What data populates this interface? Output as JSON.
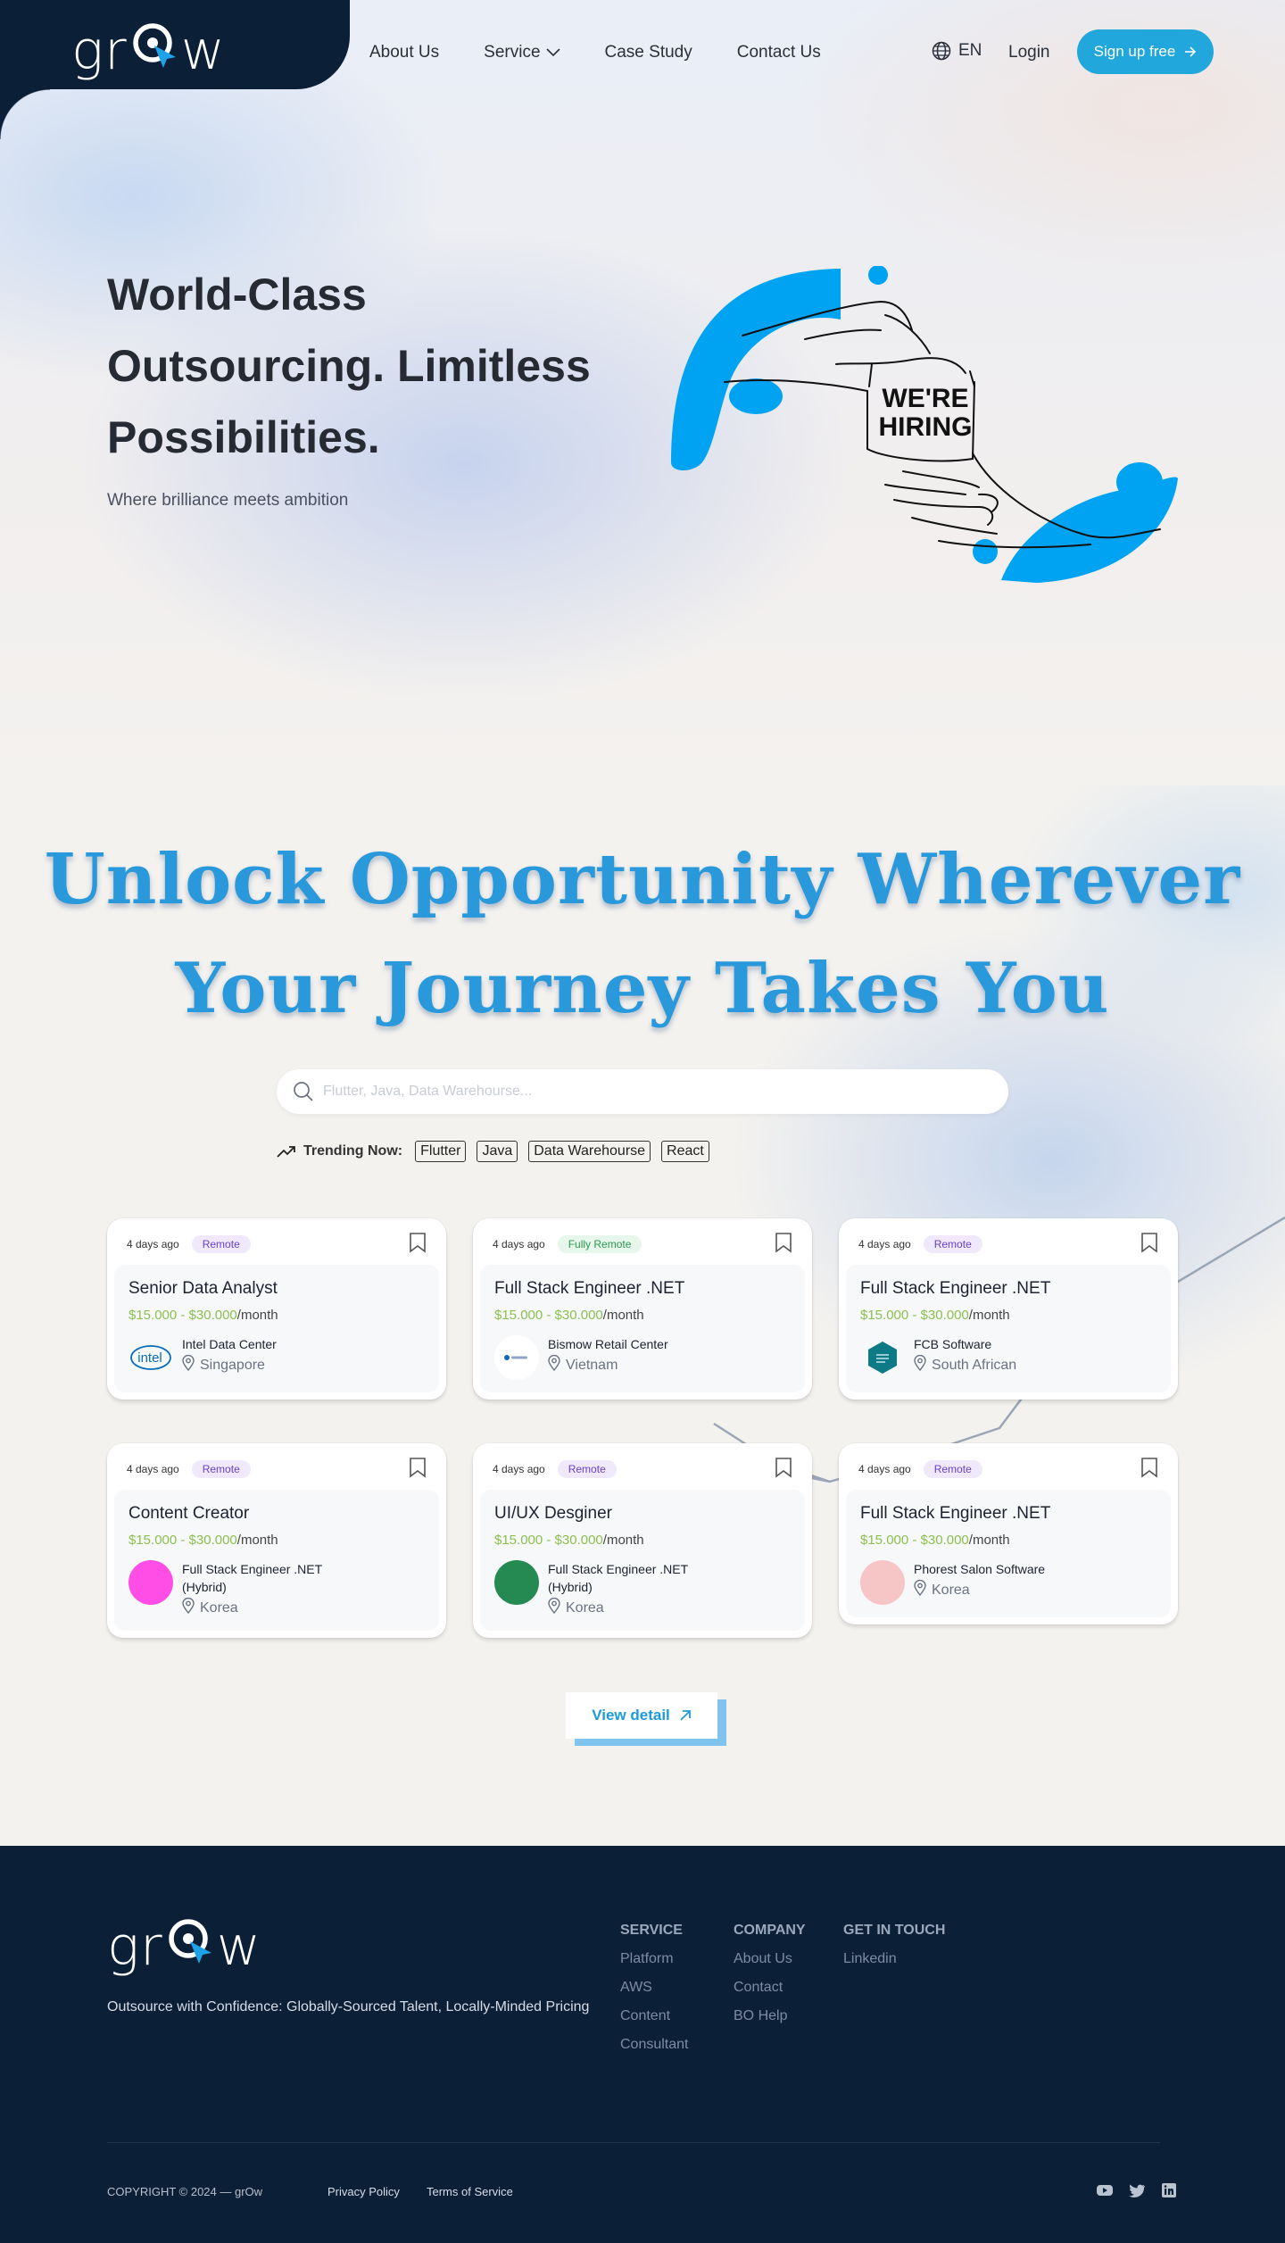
{
  "brand": {
    "logo_text_left": "gr",
    "logo_text_right": "w",
    "accent": "#22a7dc",
    "dark": "#0b1f36"
  },
  "nav": {
    "items": [
      "About Us",
      "Service",
      "Case Study",
      "Contact Us"
    ],
    "language": "EN",
    "login": "Login",
    "signup": "Sign up free"
  },
  "hero": {
    "title": "World-Class Outsourcing. Limitless Possibilities.",
    "subtitle": "Where brilliance meets ambition",
    "art_text_1": "WE'RE",
    "art_text_2": "HIRING"
  },
  "unlock": {
    "line1": "Unlock Opportunity Wherever",
    "line2": "Your Journey Takes You"
  },
  "search": {
    "placeholder": "Flutter, Java, Data Warehourse..."
  },
  "trending": {
    "label": "Trending Now:",
    "tags": [
      "Flutter",
      "Java",
      "Data Warehourse",
      "React"
    ]
  },
  "jobs": [
    {
      "ago": "4 days ago",
      "badge": "Remote",
      "role": "Senior Data Analyst",
      "salary": "$15.000 - $30.000",
      "per": "/month",
      "company": "Intel Data Center",
      "location": "Singapore"
    },
    {
      "ago": "4 days ago",
      "badge": "Fully Remote",
      "role": "Full Stack Engineer .NET",
      "salary": "$15.000 - $30.000",
      "per": "/month",
      "company": "Bismow Retail Center",
      "location": "Vietnam"
    },
    {
      "ago": "4 days ago",
      "badge": "Remote",
      "role": "Full Stack Engineer .NET",
      "salary": "$15.000 - $30.000",
      "per": "/month",
      "company": "FCB Software",
      "location": "South African"
    },
    {
      "ago": "4 days ago",
      "badge": "Remote",
      "role": "Content Creator",
      "salary": "$15.000 - $30.000",
      "per": "/month",
      "company": "Full Stack Engineer .NET (Hybrid)",
      "location": "Korea"
    },
    {
      "ago": "4 days ago",
      "badge": "Remote",
      "role": "UI/UX Desginer",
      "salary": "$15.000 - $30.000",
      "per": "/month",
      "company": "Full Stack Engineer .NET (Hybrid)",
      "location": "Korea"
    },
    {
      "ago": "4 days ago",
      "badge": "Remote",
      "role": "Full Stack Engineer .NET",
      "salary": "$15.000 - $30.000",
      "per": "/month",
      "company": "Phorest Salon Software",
      "location": "Korea"
    }
  ],
  "intel_logo_text": "intel",
  "view_detail": "View detail",
  "footer": {
    "tagline": "Outsource with Confidence: Globally-Sourced Talent, Locally-Minded Pricing",
    "columns": [
      {
        "title": "SERVICE",
        "links": [
          "Platform",
          "AWS",
          "Content",
          "Consultant"
        ]
      },
      {
        "title": "COMPANY",
        "links": [
          "About Us",
          "Contact",
          "BO Help"
        ]
      },
      {
        "title": "GET IN TOUCH",
        "links": [
          "Linkedin"
        ]
      }
    ],
    "copyright": "COPYRIGHT © 2024 — grOw",
    "privacy": "Privacy Policy",
    "terms": "Terms of Service"
  }
}
